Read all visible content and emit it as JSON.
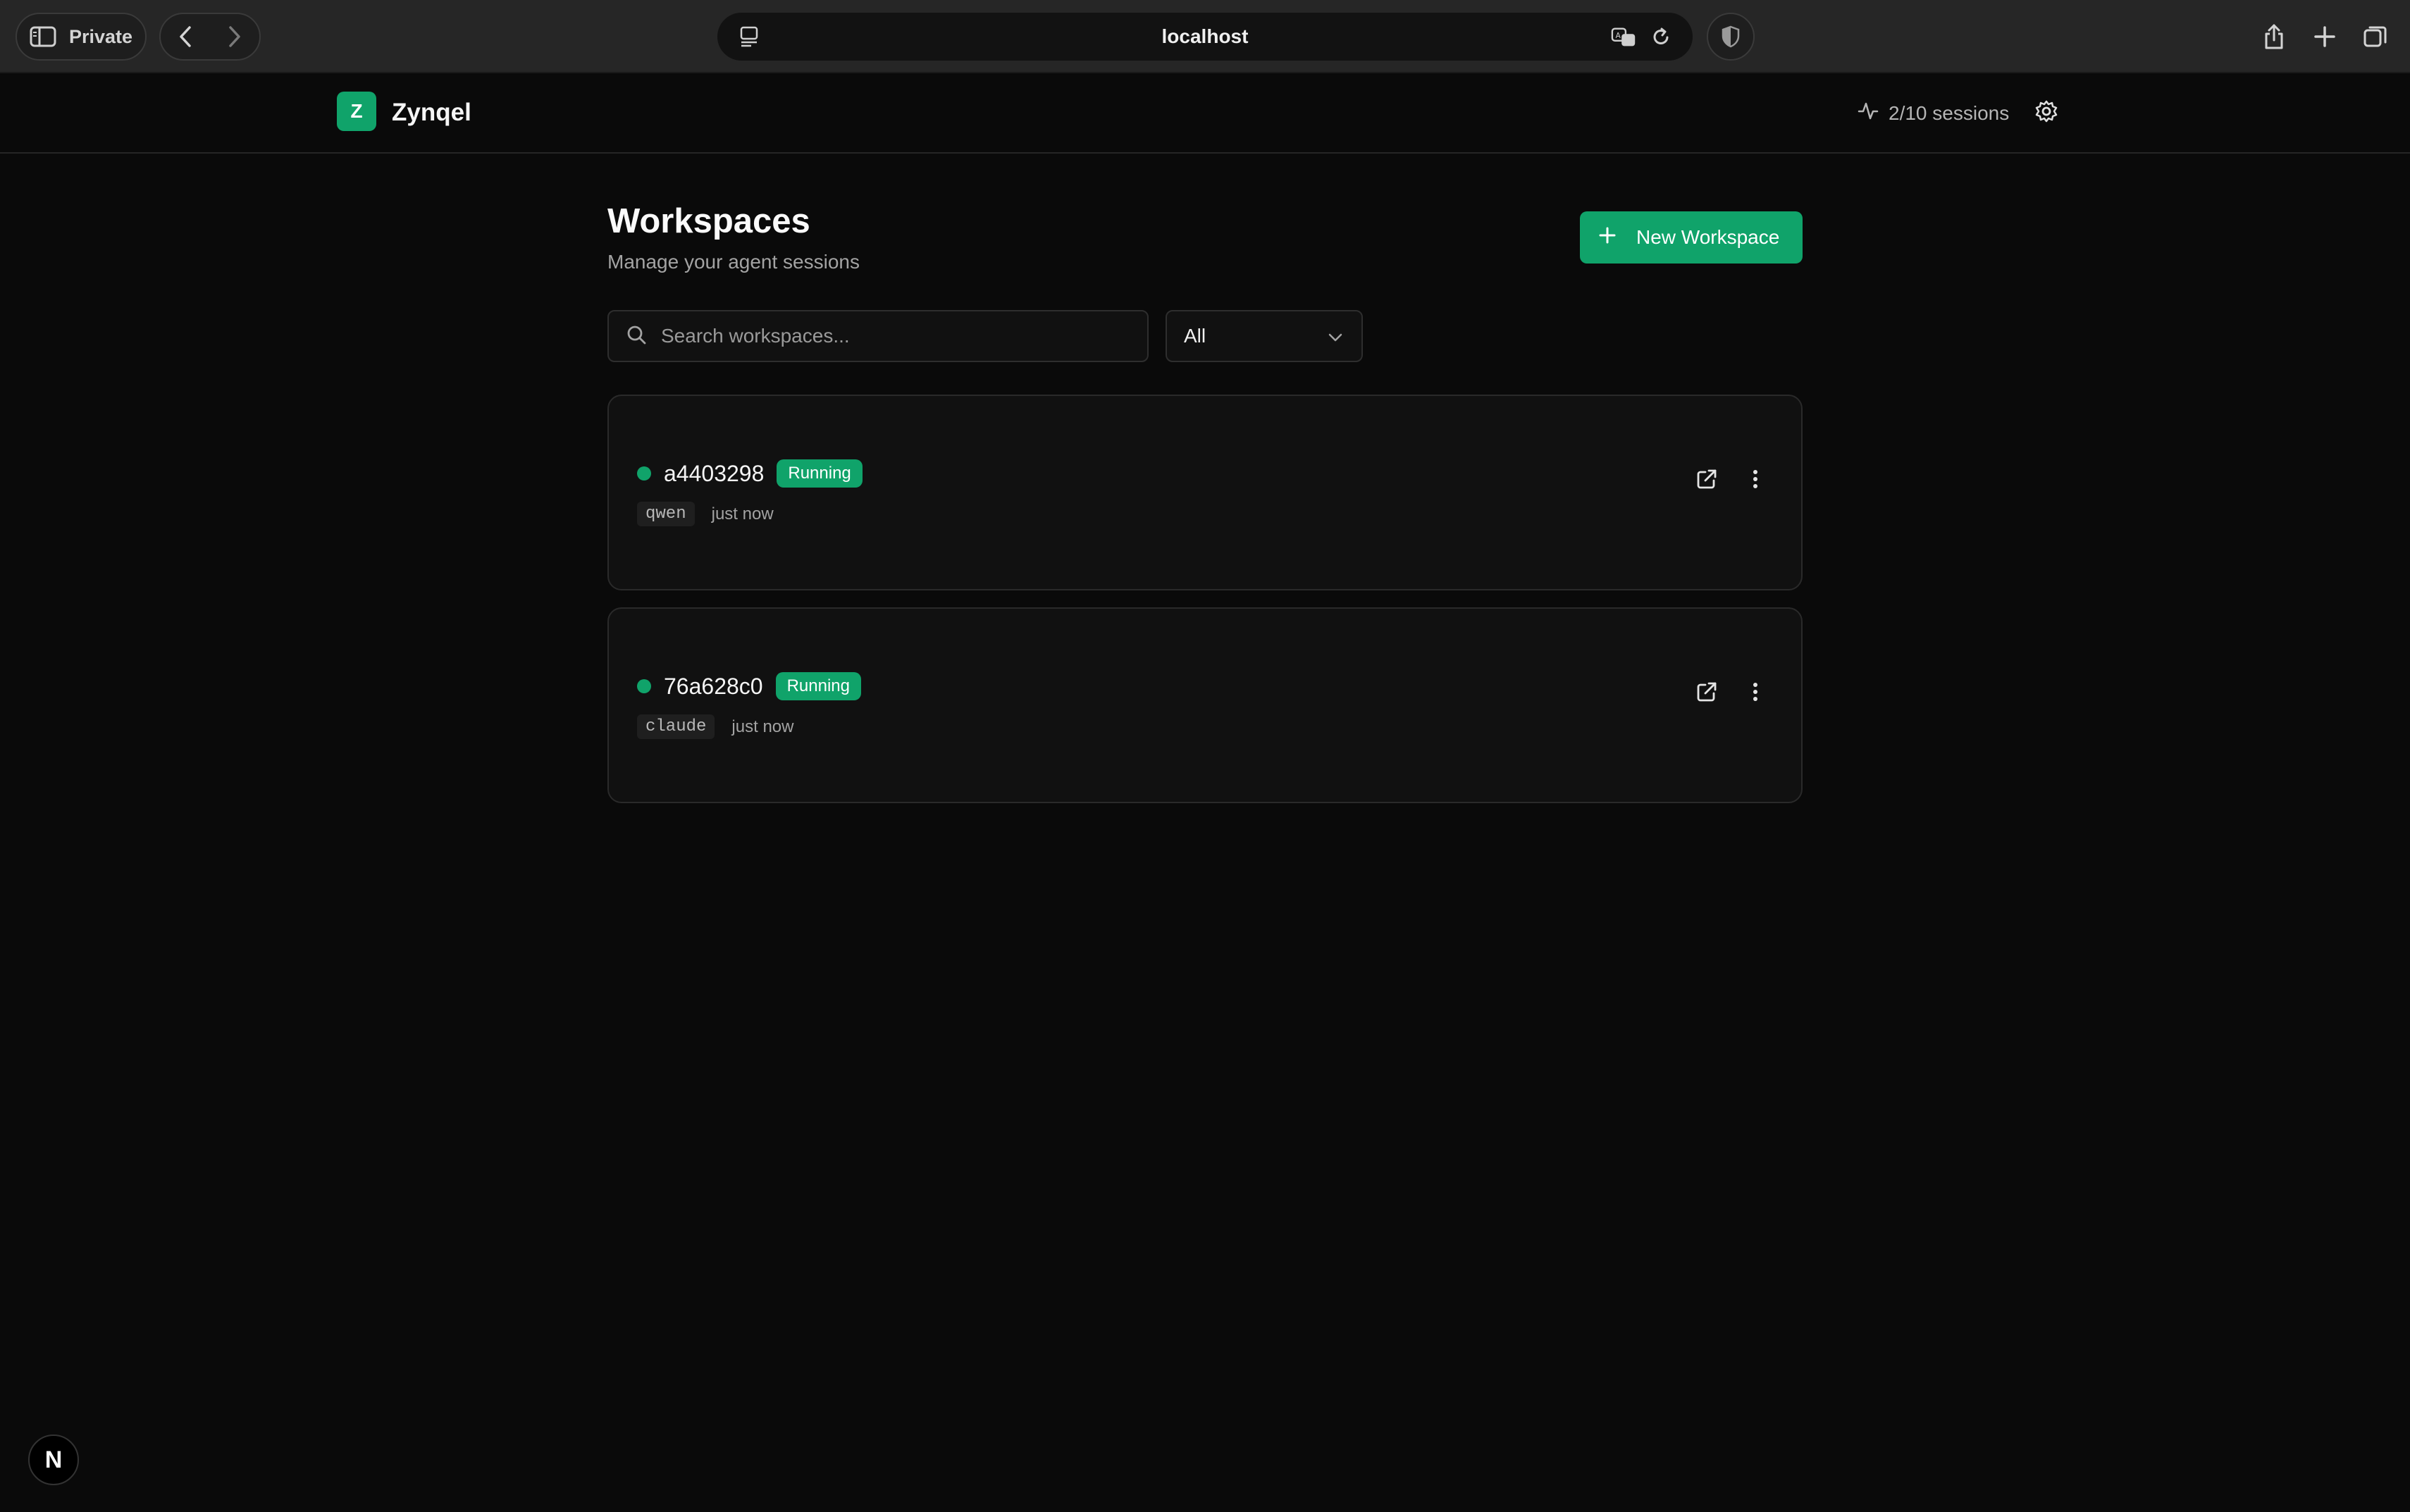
{
  "browser": {
    "private_label": "Private",
    "url": "localhost"
  },
  "header": {
    "logo_letter": "Z",
    "brand": "Zynqel",
    "sessions": "2/10 sessions"
  },
  "main": {
    "title": "Workspaces",
    "subtitle": "Manage your agent sessions",
    "new_button_label": "New Workspace",
    "search_placeholder": "Search workspaces...",
    "filter_value": "All",
    "workspaces": [
      {
        "id": "a4403298",
        "status": "Running",
        "model": "qwen",
        "time": "just now"
      },
      {
        "id": "76a628c0",
        "status": "Running",
        "model": "claude",
        "time": "just now"
      }
    ]
  },
  "devtools_badge": "N",
  "colors": {
    "accent": "#10a36a",
    "background": "#0a0a0a",
    "card": "#111111"
  }
}
